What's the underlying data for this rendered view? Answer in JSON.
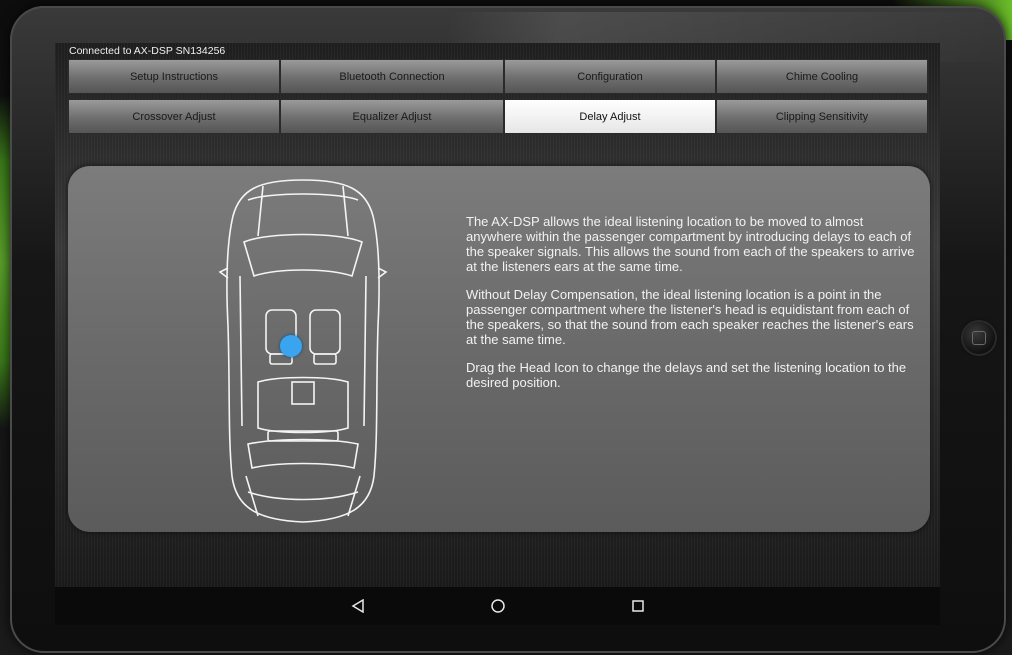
{
  "status": {
    "connected_text": "Connected to AX-DSP SN134256"
  },
  "tabs_row1": [
    {
      "label": "Setup Instructions"
    },
    {
      "label": "Bluetooth Connection"
    },
    {
      "label": "Configuration"
    },
    {
      "label": "Chime Cooling"
    }
  ],
  "tabs_row2": [
    {
      "label": "Crossover Adjust"
    },
    {
      "label": "Equalizer Adjust"
    },
    {
      "label": "Delay Adjust"
    },
    {
      "label": "Clipping Sensitivity"
    }
  ],
  "active_tab": "Delay Adjust",
  "description": {
    "p1": "The AX-DSP allows the ideal listening location to be moved to almost anywhere within the passenger compartment by introducing delays to each of the speaker signals. This allows the sound from each of the speakers to arrive at the listeners ears at the same time.",
    "p2": "Without Delay Compensation, the ideal listening location is a point in the passenger compartment where the listener's head is equidistant from each of the speakers, so that the sound from each speaker reaches the listener's ears at the same time.",
    "p3": "Drag the Head Icon to change the delays and set the listening location to the desired position."
  },
  "icons": {
    "head": "head-icon",
    "back": "back-icon",
    "home": "home-icon",
    "recents": "recents-icon"
  },
  "colors": {
    "head_icon": "#3aa4ee",
    "active_tab": "#ffffff"
  }
}
